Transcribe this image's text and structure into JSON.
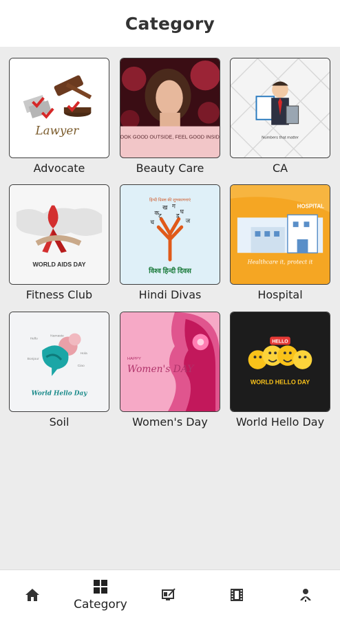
{
  "header": {
    "title": "Category"
  },
  "categories": [
    {
      "label": "Advocate",
      "thumb_text": "Lawyer"
    },
    {
      "label": "Beauty Care",
      "thumb_text": "LOOK GOOD OUTSIDE, FEEL GOOD INSIDE"
    },
    {
      "label": "CA",
      "thumb_text": ""
    },
    {
      "label": "Fitness Club",
      "thumb_text": "WORLD AIDS DAY"
    },
    {
      "label": "Hindi Divas",
      "thumb_text": "विश्व हिन्दी दिवस"
    },
    {
      "label": "Hospital",
      "thumb_text": "HOSPITAL",
      "thumb_subtext": "Healthcare it, protect it"
    },
    {
      "label": "Soil",
      "thumb_text": "World Hello Day"
    },
    {
      "label": "Women's Day",
      "thumb_text": "Women's DAY",
      "thumb_pre": "HAPPY"
    },
    {
      "label": "World Hello Day",
      "thumb_text": "WORLD HELLO DAY"
    }
  ],
  "bottom_nav": [
    {
      "icon": "home-icon",
      "label": ""
    },
    {
      "icon": "grid-icon",
      "label": "Category",
      "active": true
    },
    {
      "icon": "design-icon",
      "label": ""
    },
    {
      "icon": "video-icon",
      "label": ""
    },
    {
      "icon": "profile-icon",
      "label": ""
    }
  ],
  "colors": {
    "header_bg": "#ffffff",
    "page_bg": "#ececec",
    "text": "#222222"
  }
}
